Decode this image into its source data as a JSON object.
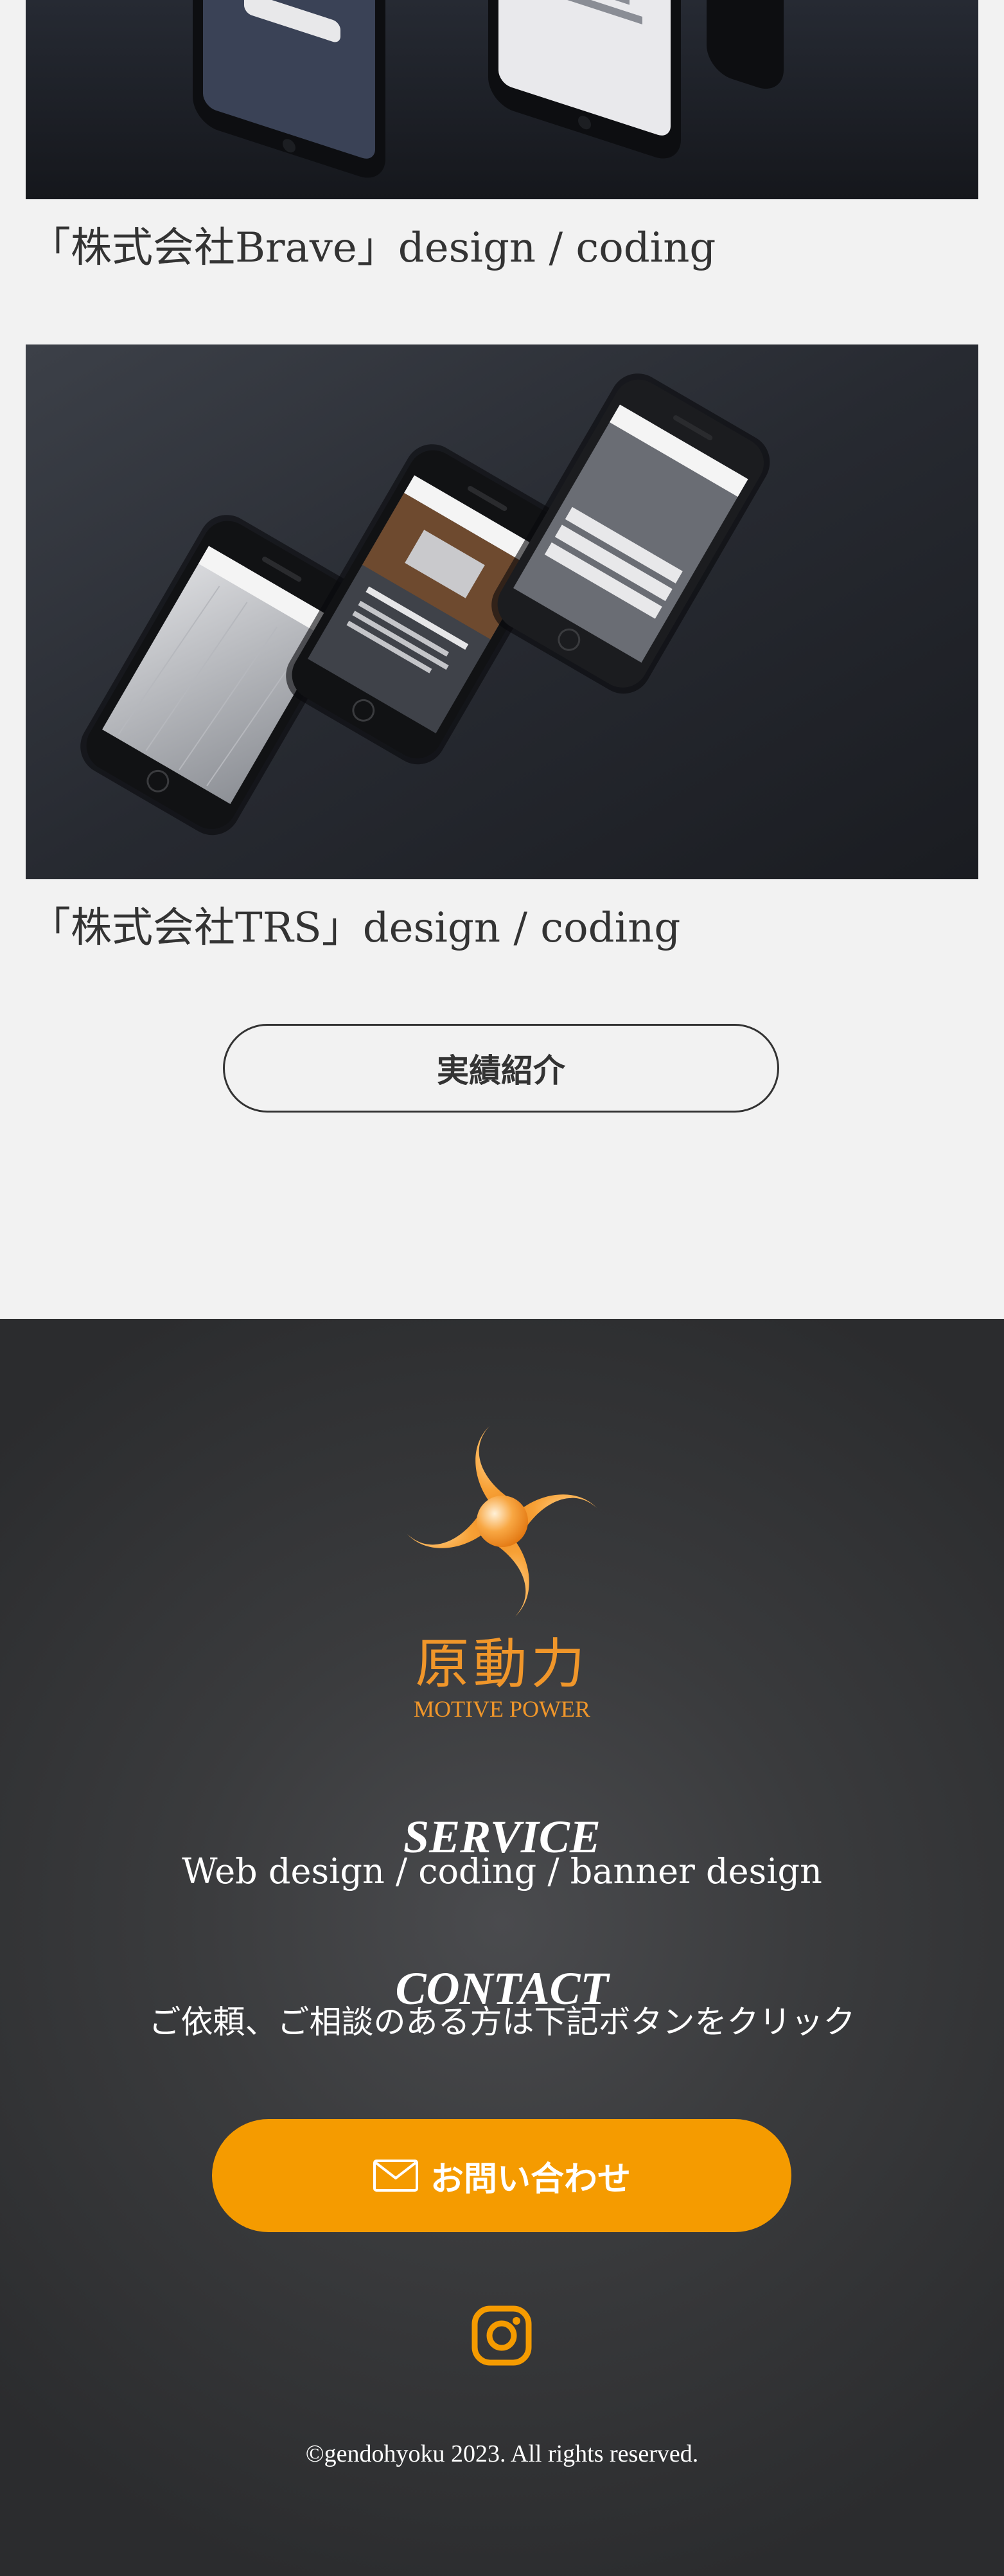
{
  "works": {
    "items": [
      {
        "caption": "「株式会社Brave」design / coding"
      },
      {
        "caption": "「株式会社TRS」design / coding"
      }
    ],
    "more_button": "実績紹介"
  },
  "footer": {
    "logo": {
      "kanji": "原動力",
      "english": "MOTIVE POWER"
    },
    "service": {
      "title": "SERVICE",
      "text": "Web design / coding / banner design"
    },
    "contact": {
      "title": "CONTACT",
      "text": "ご依頼、ご相談のある方は下記ボタンをクリック",
      "button_label": "お問い合わせ"
    },
    "copyright": "©gendohyoku 2023. All rights reserved."
  },
  "icons": {
    "mail": "mail-icon",
    "instagram": "instagram-icon",
    "logo": "pinwheel-logo"
  },
  "colors": {
    "accent": "#f59b00",
    "logo_orange": "#f0962a",
    "footer_bg": "#2f3032",
    "page_bg": "#f2f2f2",
    "text_dark": "#333333"
  }
}
